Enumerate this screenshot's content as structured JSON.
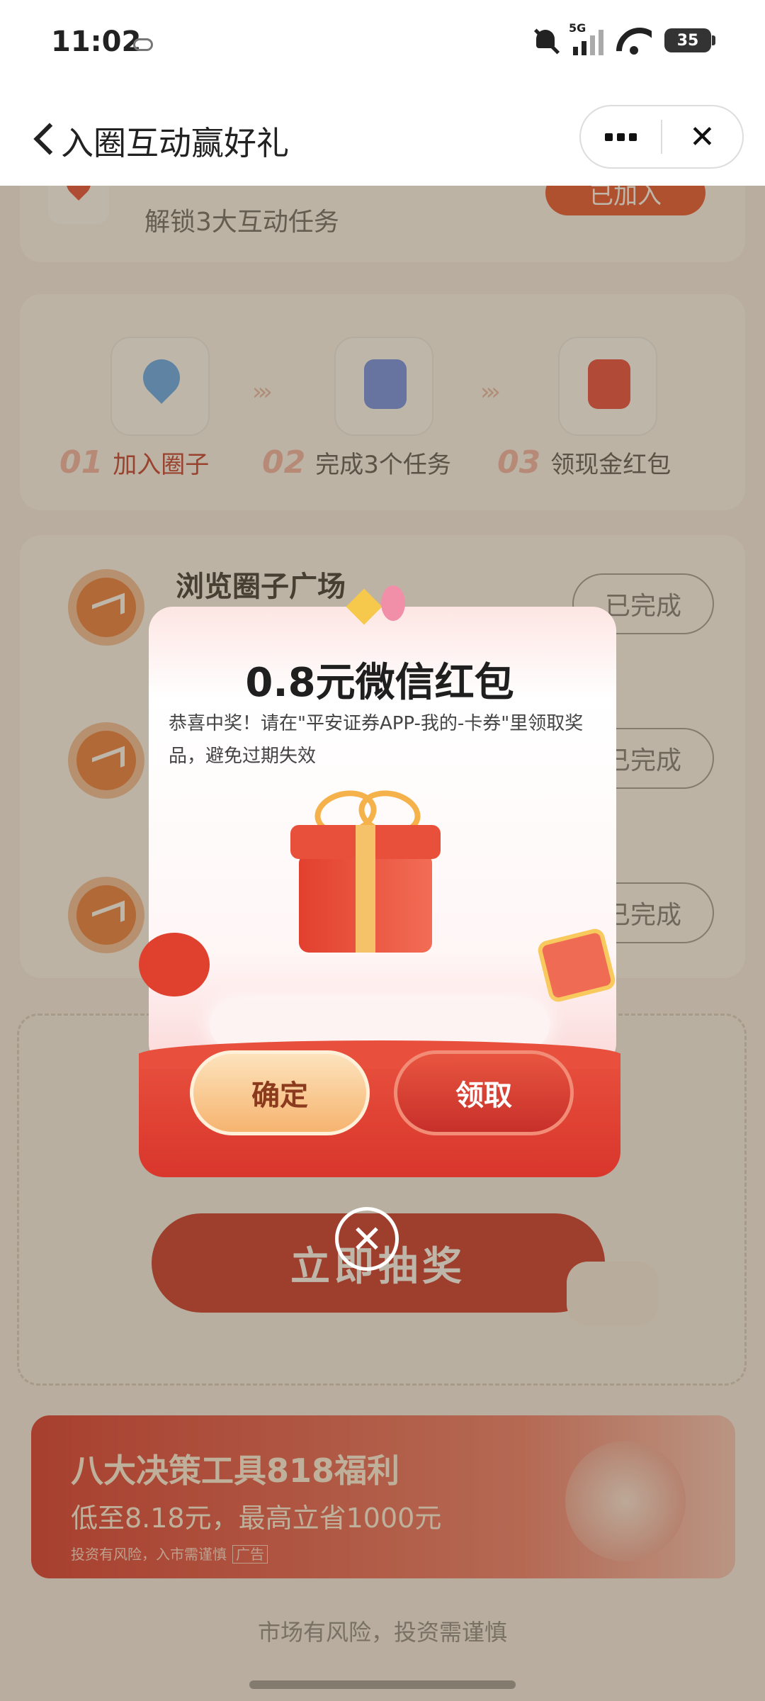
{
  "status_bar": {
    "time": "11:02",
    "network": "5G",
    "battery": "35"
  },
  "header": {
    "title": "入圈互动赢好礼",
    "more_icon": "more-icon",
    "close_icon": "close-icon"
  },
  "join_card": {
    "text": "解锁3大互动任务",
    "button": "已加入"
  },
  "steps": [
    {
      "num": "01",
      "label": "加入圈子"
    },
    {
      "num": "02",
      "label": "完成3个任务"
    },
    {
      "num": "03",
      "label": "领现金红包"
    }
  ],
  "tasks": [
    {
      "name": "浏览圈子广场",
      "button": "已完成"
    },
    {
      "name": "",
      "button": "已完成"
    },
    {
      "name": "",
      "button": "已完成"
    }
  ],
  "lottery": {
    "button": "立即抽奖"
  },
  "banner": {
    "title": "八大决策工具818福利",
    "subtitle": "低至8.18元，最高立省1000元",
    "disclaimer": "投资有风险，入市需谨慎",
    "ad_tag": "广告"
  },
  "footer": {
    "note": "市场有风险，投资需谨慎"
  },
  "modal": {
    "amount": "0.8元微信红包",
    "description": "恭喜中奖！请在\"平安证券APP-我的-卡券\"里领取奖品，避免过期失效",
    "confirm_button": "确定",
    "claim_button": "领取",
    "close_symbol": "✕"
  }
}
